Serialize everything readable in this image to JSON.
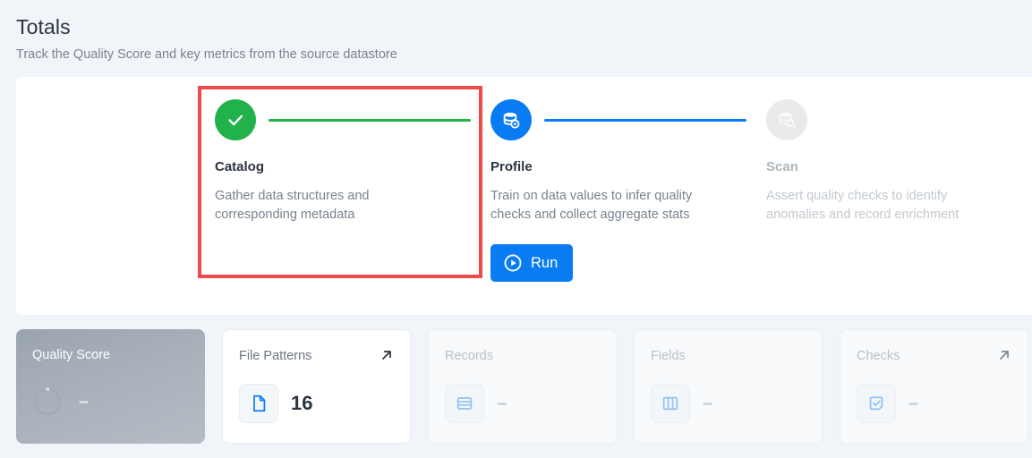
{
  "header": {
    "title": "Totals",
    "subtitle": "Track the Quality Score and key metrics from the source datastore"
  },
  "steps": [
    {
      "name": "Catalog",
      "description": "Gather data structures and corresponding metadata",
      "state": "done",
      "icon": "check-icon",
      "connector_color": "#22b24c",
      "circle_color": "#22b24c"
    },
    {
      "name": "Profile",
      "description": "Train on data values to infer quality checks and collect aggregate stats",
      "state": "active",
      "icon": "database-profile-icon",
      "connector_color": "#0a7cf3",
      "circle_color": "#0a7cf3",
      "action_label": "Run",
      "action_icon": "play-circle-icon"
    },
    {
      "name": "Scan",
      "description": "Assert quality checks to identify anomalies and record enrichment",
      "state": "disabled",
      "icon": "database-search-icon",
      "circle_color": "#e8eaec"
    }
  ],
  "highlight": {
    "color": "#ef4b4b",
    "target": "Catalog"
  },
  "metrics": [
    {
      "label": "Quality Score",
      "value": "–",
      "style": "score",
      "icon": "progress-ring-icon",
      "has_link": false
    },
    {
      "label": "File Patterns",
      "value": "16",
      "style": "plain",
      "icon": "file-icon",
      "has_link": true,
      "link_icon": "arrow-up-right-icon"
    },
    {
      "label": "Records",
      "value": "–",
      "style": "faded",
      "icon": "rows-icon",
      "has_link": false
    },
    {
      "label": "Fields",
      "value": "–",
      "style": "faded",
      "icon": "columns-icon",
      "has_link": false
    },
    {
      "label": "Checks",
      "value": "–",
      "style": "faded",
      "icon": "check-square-icon",
      "has_link": true,
      "link_icon": "arrow-up-right-icon"
    }
  ],
  "colors": {
    "accent_blue": "#0a7cf3",
    "success_green": "#22b24c",
    "highlight_red": "#ef4b4b",
    "page_bg": "#f1f5f9"
  }
}
